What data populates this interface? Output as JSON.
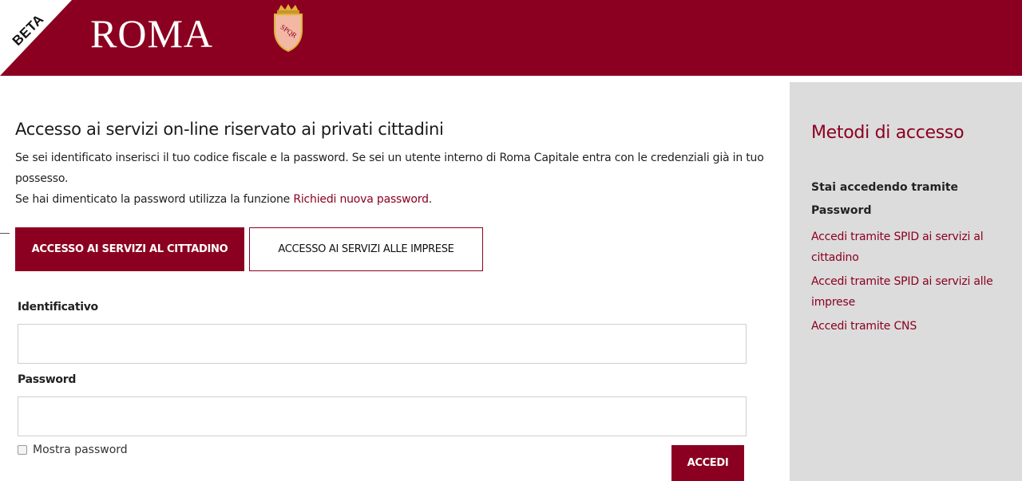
{
  "header": {
    "badge": "BETA",
    "logo_text": "ROMA",
    "crest_label": "SPQR",
    "colors": {
      "brand": "#8b0020"
    }
  },
  "main": {
    "title": "Accesso ai servizi on-line riservato ai privati cittadini",
    "intro_line1": "Se sei identificato inserisci il tuo codice fiscale e la password. Se sei un utente interno di Roma Capitale entra con le credenziali già in tuo possesso.",
    "intro_line2_prefix": "Se hai dimenticato la password utilizza la funzione ",
    "intro_link": "Richiedi nuova password",
    "intro_line2_suffix": "."
  },
  "tabs": [
    {
      "label": "ACCESSO AI SERVIZI AL CITTADINO",
      "active": true
    },
    {
      "label": "ACCESSO AI SERVIZI ALLE IMPRESE",
      "active": false
    }
  ],
  "form": {
    "id_label": "Identificativo",
    "id_value": "",
    "password_label": "Password",
    "password_value": "",
    "show_password_label": "Mostra password",
    "submit_label": "ACCEDI"
  },
  "sidebar": {
    "title": "Metodi di accesso",
    "current": "Stai accedendo tramite Password",
    "links": [
      "Accedi tramite SPID ai servizi al cittadino",
      "Accedi tramite SPID ai servizi alle imprese",
      "Accedi tramite CNS"
    ]
  }
}
